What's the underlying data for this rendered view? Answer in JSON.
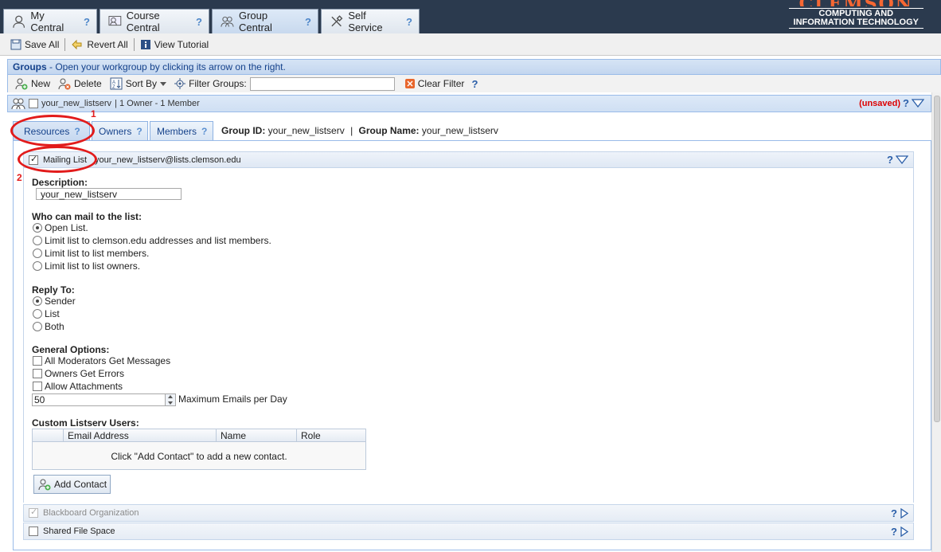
{
  "top_tabs": [
    {
      "label": "My Central",
      "icon": "user-icon"
    },
    {
      "label": "Course Central",
      "icon": "course-icon"
    },
    {
      "label": "Group Central",
      "icon": "group-icon"
    },
    {
      "label": "Self Service",
      "icon": "tools-icon"
    }
  ],
  "help_mark": "?",
  "brand": {
    "logo_text": "CLEMSON",
    "line1": "COMPUTING AND",
    "line2": "INFORMATION TECHNOLOGY"
  },
  "toolbar": {
    "save_all": "Save All",
    "revert_all": "Revert All",
    "view_tutorial": "View Tutorial"
  },
  "groups_panel": {
    "title": "Groups",
    "subtitle": " - Open your workgroup by clicking its arrow on the right.",
    "new_label": "New",
    "delete_label": "Delete",
    "sort_label": "Sort By",
    "filter_label": "Filter Groups:",
    "filter_value": "",
    "clear_filter": "Clear Filter"
  },
  "group": {
    "name": "your_new_listserv",
    "summary": " |  1 Owner  -  1 Member",
    "unsaved": "(unsaved)",
    "id_label": "Group ID:",
    "id_value": "your_new_listserv",
    "sep": "|",
    "name_label": "Group Name:",
    "name_value": "your_new_listserv"
  },
  "inner_tabs": [
    "Resources",
    "Owners",
    "Members"
  ],
  "mailing_list": {
    "label": "Mailing List",
    "address": "your_new_listserv@lists.clemson.edu",
    "description_label": "Description:",
    "description_value": "your_new_listserv",
    "who_label": "Who can mail to the list:",
    "who_options": [
      "Open List.",
      "Limit list to clemson.edu addresses and list members.",
      "Limit list to list members.",
      "Limit list to list owners."
    ],
    "reply_label": "Reply To:",
    "reply_options": [
      "Sender",
      "List",
      "Both"
    ],
    "general_label": "General Options:",
    "general_options": [
      "All Moderators Get Messages",
      "Owners Get Errors",
      "Allow Attachments"
    ],
    "max_emails_value": "50",
    "max_emails_label": "Maximum Emails per Day",
    "custom_label": "Custom Listserv Users:",
    "table_headers": [
      "Email Address",
      "Name",
      "Role"
    ],
    "empty_message": "Click \"Add Contact\" to add a new contact.",
    "add_contact": "Add Contact"
  },
  "sections": [
    "Blackboard Organization",
    "Shared File Space"
  ],
  "annotations": [
    "1",
    "2"
  ]
}
